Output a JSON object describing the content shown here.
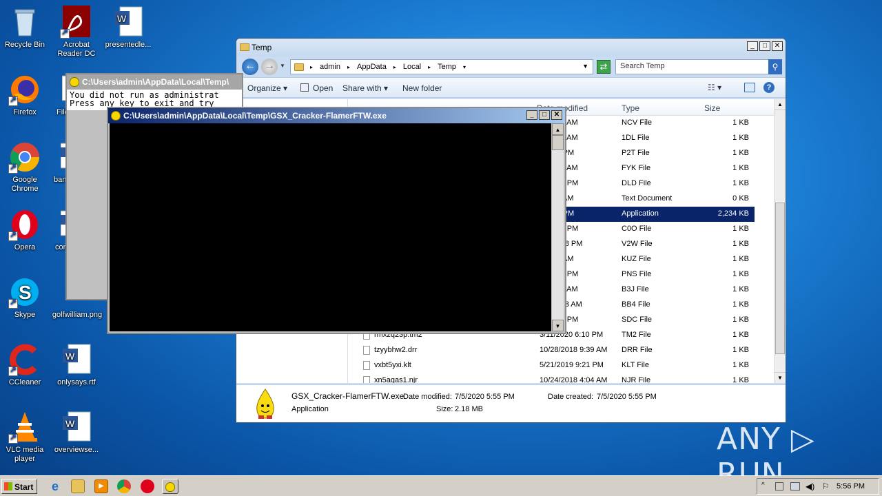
{
  "desktop_icons": [
    {
      "label": "Recycle Bin"
    },
    {
      "label": "Acrobat Reader DC"
    },
    {
      "label": "presentedle..."
    },
    {
      "label": "Firefox"
    },
    {
      "label": "File"
    },
    {
      "label": "Google Chrome"
    },
    {
      "label": "ban"
    },
    {
      "label": "Opera"
    },
    {
      "label": "con"
    },
    {
      "label": "Skype"
    },
    {
      "label": "golfwilliam.png"
    },
    {
      "label": "CCleaner"
    },
    {
      "label": "onlysays.rtf"
    },
    {
      "label": "VLC media player"
    },
    {
      "label": "overviewse..."
    }
  ],
  "explorer": {
    "title": "Temp",
    "breadcrumb": [
      "admin",
      "AppData",
      "Local",
      "Temp"
    ],
    "search_placeholder": "Search Temp",
    "toolbar": {
      "organize": "Organize",
      "open": "Open",
      "share_with": "Share with",
      "new_folder": "New folder"
    },
    "columns": {
      "date": "Date modified",
      "type": "Type",
      "size": "Size"
    },
    "rows": [
      {
        "name": "",
        "date": "18 5:23 AM",
        "type": "NCV File",
        "size": "1 KB"
      },
      {
        "name": "",
        "date": "17 9:54 AM",
        "type": "1DL File",
        "size": "1 KB"
      },
      {
        "name": "",
        "date": "0 4:08 PM",
        "type": "P2T File",
        "size": "1 KB"
      },
      {
        "name": "",
        "date": "20 1:47 AM",
        "type": "FYK File",
        "size": "1 KB"
      },
      {
        "name": "",
        "date": "18 4:55 PM",
        "type": "DLD File",
        "size": "1 KB"
      },
      {
        "name": "",
        "date": "3 9:52 AM",
        "type": "Text Document",
        "size": "0 KB"
      },
      {
        "name": "",
        "date": "0 5:55 PM",
        "type": "Application",
        "size": "2,234 KB"
      },
      {
        "name": "",
        "date": "19 9:10 PM",
        "type": "C0O File",
        "size": "1 KB"
      },
      {
        "name": "",
        "date": "018 7:08 PM",
        "type": "V2W File",
        "size": "1 KB"
      },
      {
        "name": "",
        "date": "0 9:14 AM",
        "type": "KUZ File",
        "size": "1 KB"
      },
      {
        "name": "",
        "date": "19 9:31 PM",
        "type": "PNS File",
        "size": "1 KB"
      },
      {
        "name": "",
        "date": "17 3:00 AM",
        "type": "B3J File",
        "size": "1 KB"
      },
      {
        "name": "",
        "date": "019 9:03 AM",
        "type": "BB4 File",
        "size": "1 KB"
      },
      {
        "name": "",
        "date": "18 2:20 PM",
        "type": "SDC File",
        "size": "1 KB"
      },
      {
        "name": "rmxzq23p.tm2",
        "date": "3/11/2020 6:10 PM",
        "type": "TM2 File",
        "size": "1 KB"
      },
      {
        "name": "tzyybhw2.drr",
        "date": "10/28/2018 9:39 AM",
        "type": "DRR File",
        "size": "1 KB"
      },
      {
        "name": "vxbt5yxi.klt",
        "date": "5/21/2019 9:21 PM",
        "type": "KLT File",
        "size": "1 KB"
      },
      {
        "name": "xn5aqas1.njr",
        "date": "10/24/2018 4:04 AM",
        "type": "NJR File",
        "size": "1 KB"
      }
    ],
    "details": {
      "filename": "GSX_Cracker-FlamerFTW.exe",
      "type": "Application",
      "date_modified_label": "Date modified:",
      "date_modified": "7/5/2020 5:55 PM",
      "date_created_label": "Date created:",
      "date_created": "7/5/2020 5:55 PM",
      "size_label": "Size:",
      "size": "2.18 MB"
    }
  },
  "console_back": {
    "title": "C:\\Users\\admin\\AppData\\Local\\Temp\\",
    "text": "You did not run as administrat\nPress any key to exit and try "
  },
  "console_front": {
    "title": "C:\\Users\\admin\\AppData\\Local\\Temp\\GSX_Cracker-FlamerFTW.exe"
  },
  "taskbar": {
    "start": "Start",
    "clock": "5:56 PM"
  },
  "watermark": "ANY ▷ RUN"
}
